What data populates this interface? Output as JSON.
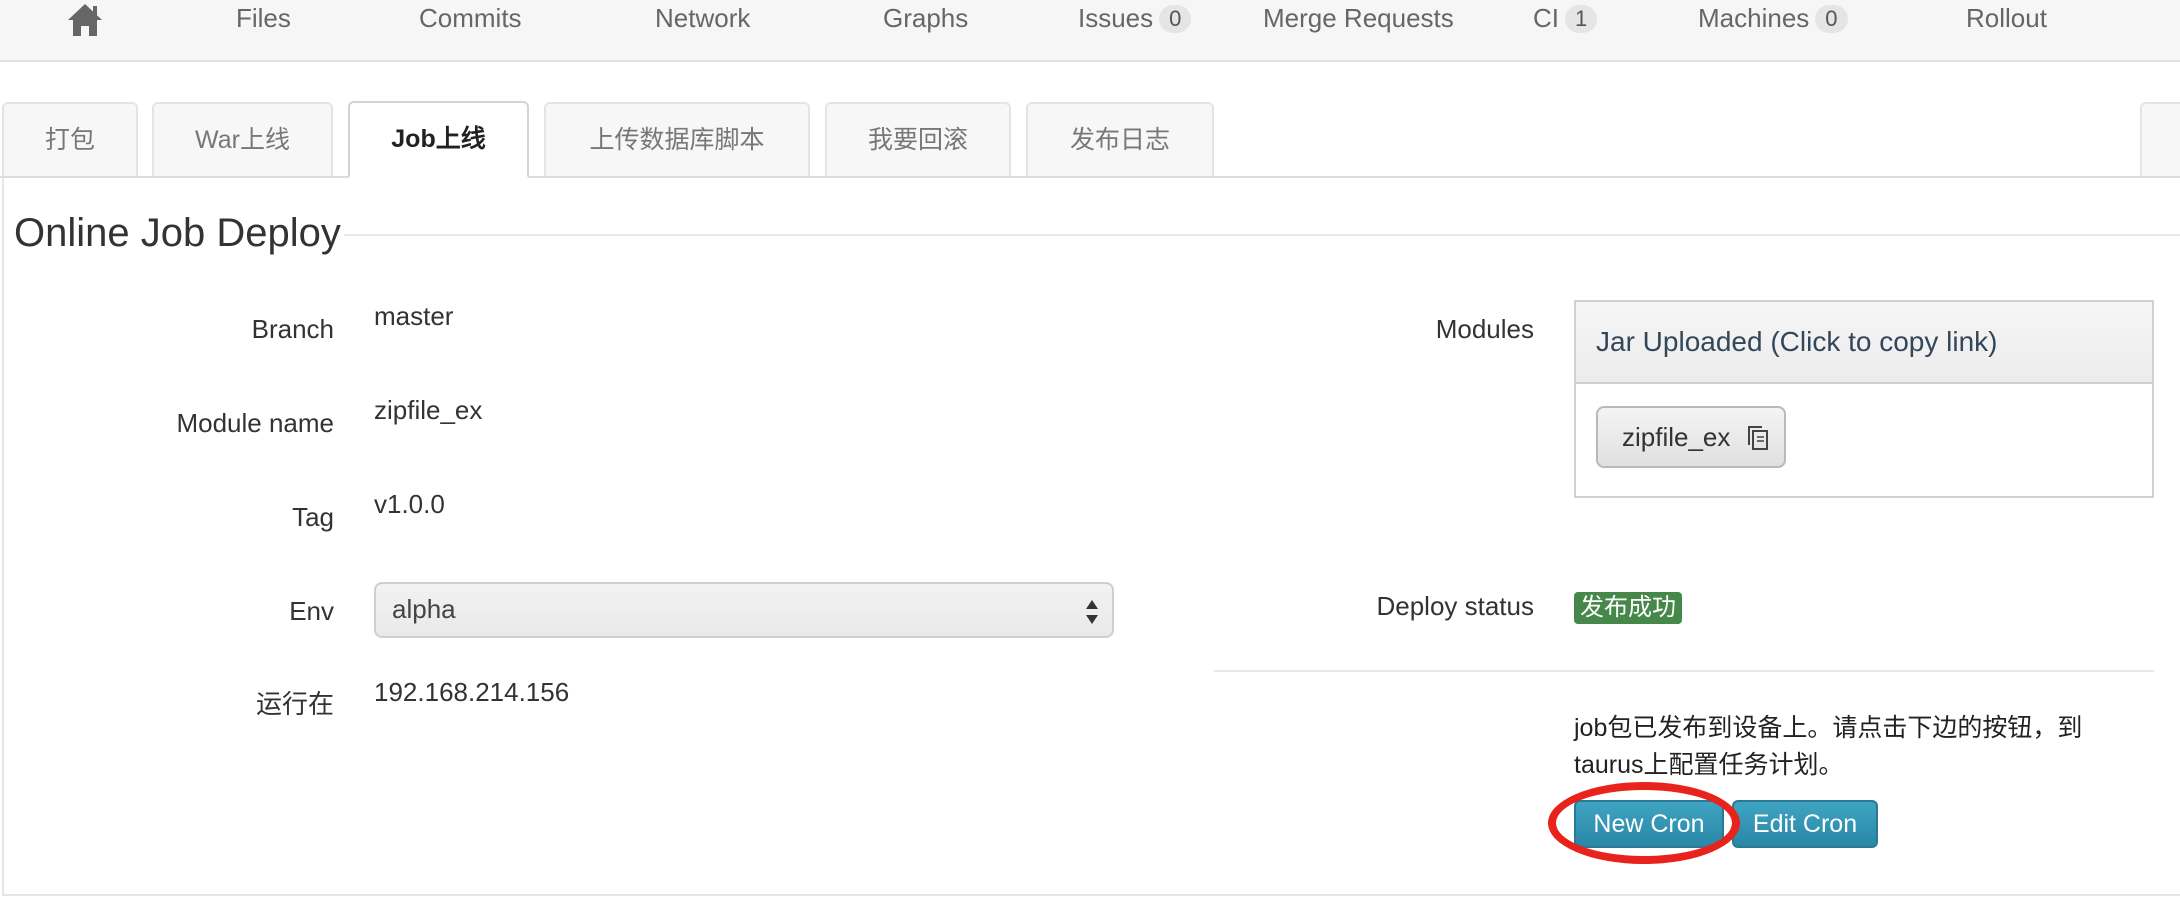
{
  "nav": {
    "home_icon": "home-icon",
    "items": [
      {
        "label": "Files"
      },
      {
        "label": "Commits"
      },
      {
        "label": "Network"
      },
      {
        "label": "Graphs"
      },
      {
        "label": "Issues",
        "count": "0"
      },
      {
        "label": "Merge Requests"
      },
      {
        "label": "CI",
        "count": "1"
      },
      {
        "label": "Machines",
        "count": "0"
      },
      {
        "label": "Rollout"
      }
    ]
  },
  "tabs": [
    {
      "label": "打包"
    },
    {
      "label": "War上线"
    },
    {
      "label": "Job上线",
      "active": true
    },
    {
      "label": "上传数据库脚本"
    },
    {
      "label": "我要回滚"
    },
    {
      "label": "发布日志"
    }
  ],
  "form": {
    "title": "Online Job Deploy",
    "branch_label": "Branch",
    "branch_value": "master",
    "module_label": "Module name",
    "module_value": "zipfile_ex",
    "tag_label": "Tag",
    "tag_value": "v1.0.0",
    "env_label": "Env",
    "env_value": "alpha",
    "run_on_label": "运行在",
    "run_on_value": "192.168.214.156"
  },
  "modules": {
    "label": "Modules",
    "header": "Jar Uploaded (Click to copy link)",
    "jar_button": "zipfile_ex",
    "copy_icon": "copy-icon"
  },
  "deploy": {
    "status_label": "Deploy status",
    "status_badge": "发布成功",
    "status_color": "#46884a",
    "note": "job包已发布到设备上。请点击下边的按钮，到taurus上配置任务计划。",
    "new_cron": "New Cron",
    "edit_cron": "Edit Cron",
    "button_color": "#2a87a6",
    "highlight_color": "#e8231c"
  }
}
